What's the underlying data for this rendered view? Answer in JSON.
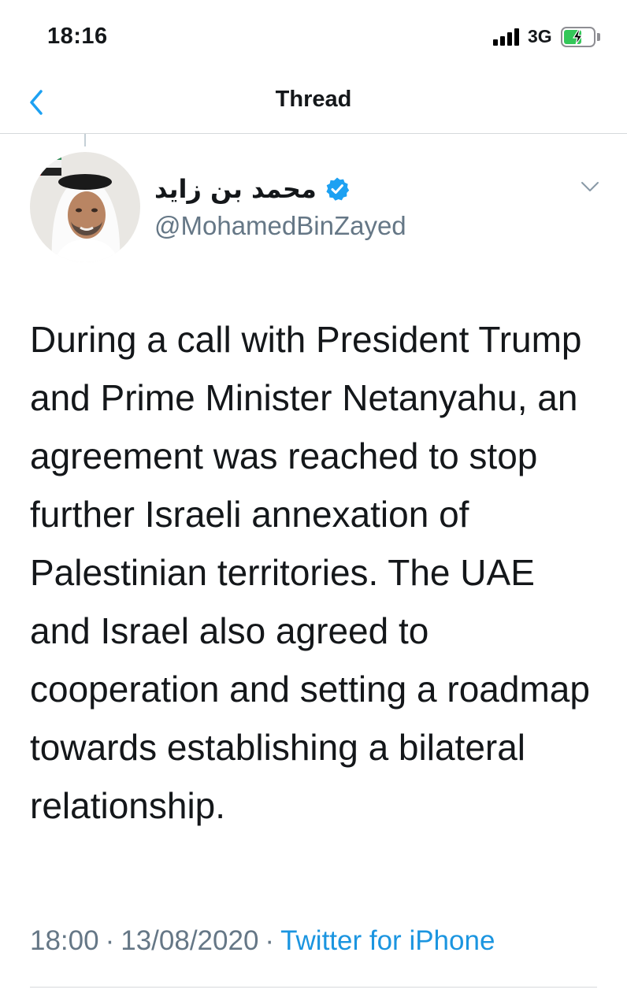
{
  "status_bar": {
    "time": "18:16",
    "network": "3G",
    "battery_charge": 0.6,
    "battery_color": "#34c759"
  },
  "nav": {
    "title": "Thread",
    "back_icon": "chevron-left-icon",
    "accent_color": "#1da1f2"
  },
  "tweet": {
    "display_name": "محمد بن زايد",
    "verified": true,
    "handle": "@MohamedBinZayed",
    "text": "During a call with President Trump and Prime Minister Netanyahu, an agreement was reached to stop further Israeli annexation of Palestinian territories. The UAE and Israel also agreed to cooperation and setting a roadmap towards establishing a bilateral relationship.",
    "time": "18:00",
    "date": "13/08/2020",
    "source": "Twitter for iPhone",
    "separator": "·"
  },
  "colors": {
    "text": "#14171a",
    "secondary": "#657786",
    "link": "#1b95e0",
    "divider": "#d6d9dc"
  }
}
